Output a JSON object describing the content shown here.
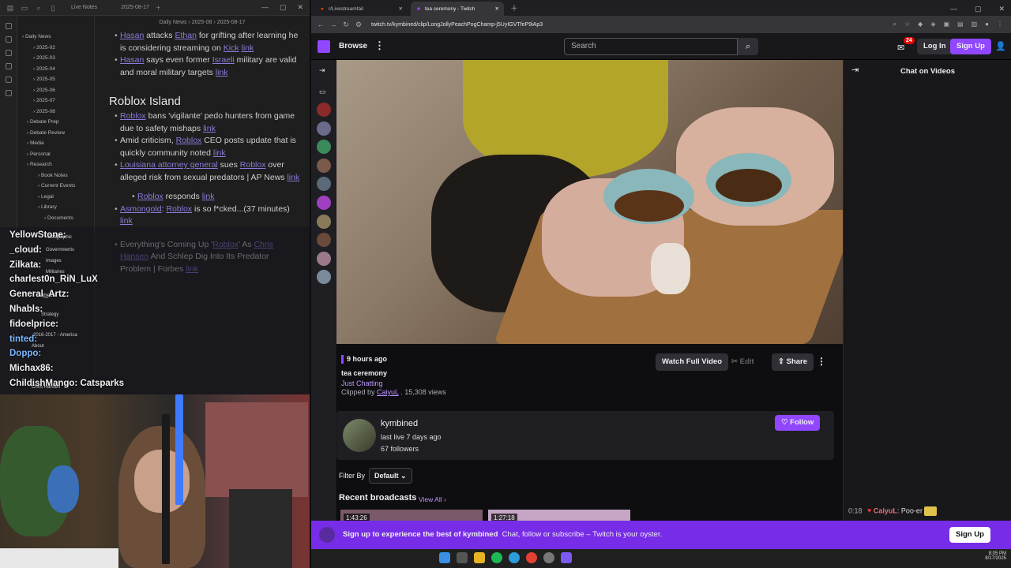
{
  "notes": {
    "window_tab": "Live Notes",
    "tab_date": "2025-08-17",
    "breadcrumb": [
      "Daily News",
      "2025-08",
      "2025-08-17"
    ],
    "tree": [
      "Daily News",
      "2025-02",
      "2025-03",
      "2025-04",
      "2025-05",
      "2025-06",
      "2025-07",
      "2025-08",
      "Debate Prep",
      "Debate Review",
      "Media",
      "Personal",
      "Research",
      "Book Notes",
      "Current Events",
      "Legal",
      "Library",
      "Documents"
    ],
    "items_top": [
      {
        "parts": [
          [
            "Hasan",
            true
          ],
          [
            " attacks ",
            false
          ],
          [
            "Ethan",
            true
          ],
          [
            " for grifting after learning he is considering streaming on ",
            false
          ],
          [
            "Kick",
            true
          ],
          [
            " ",
            false
          ],
          [
            "link",
            true
          ]
        ]
      },
      {
        "parts": [
          [
            "Hasan",
            true
          ],
          [
            " says even former ",
            false
          ],
          [
            "Israeli",
            true
          ],
          [
            " military are valid and moral military targets ",
            false
          ],
          [
            "link",
            true
          ]
        ]
      }
    ],
    "heading": "Roblox Island",
    "items_roblox": [
      {
        "parts": [
          [
            "Roblox",
            true
          ],
          [
            " bans 'vigilante' pedo hunters from game due to safety mishaps ",
            false
          ],
          [
            "link",
            true
          ]
        ]
      },
      {
        "parts": [
          [
            "Amid criticism, ",
            false
          ],
          [
            "Roblox",
            true
          ],
          [
            " CEO posts update that is quickly community noted ",
            false
          ],
          [
            "link",
            true
          ]
        ]
      },
      {
        "parts": [
          [
            "Louisiana attorney general",
            true
          ],
          [
            " sues ",
            false
          ],
          [
            "Roblox",
            true
          ],
          [
            " over alleged risk from sexual predators | AP News ",
            false
          ],
          [
            "link",
            true
          ]
        ]
      },
      {
        "parts": [
          [
            "Roblox",
            true
          ],
          [
            " responds ",
            false
          ],
          [
            "link",
            true
          ]
        ],
        "indent": true
      },
      {
        "parts": [
          [
            "Asmongold",
            true
          ],
          ": ",
          [
            "Roblox",
            true
          ],
          [
            " is so f*cked...(37 minutes) ",
            false
          ],
          [
            "link",
            true
          ]
        ]
      },
      {
        "parts": [
          [
            "Everything's Coming Up '",
            false
          ],
          [
            "Roblox",
            true
          ],
          [
            "' As ",
            false
          ],
          [
            "Chris Hansen",
            true
          ],
          [
            " And Schlep Dig Into Its Predator Problem | Forbes ",
            false
          ],
          [
            "link",
            true
          ]
        ]
      }
    ]
  },
  "overlay_chat": [
    {
      "user": "YellowStone:",
      "msg": ""
    },
    {
      "user": "_cloud:",
      "msg": ""
    },
    {
      "user": "Zilkata:",
      "msg": ""
    },
    {
      "user": "charlest0n_RiN_LuX",
      "msg": ""
    },
    {
      "user": "General_Artz:",
      "msg": ""
    },
    {
      "user": "Nhabls:",
      "msg": ""
    },
    {
      "user": "fidoelprice:",
      "msg": ""
    },
    {
      "user": "tinted:",
      "msg": ""
    },
    {
      "user": "Doppo:",
      "msg": ""
    },
    {
      "user": "Michax86:",
      "msg": ""
    },
    {
      "user": "ChildishMango:",
      "msg": "Catsparks"
    }
  ],
  "overlay_tiny": [
    "Geographic",
    "Governments",
    "Images",
    "Militaries",
    "Subjects",
    "Strategy",
    "2016-2017 - America",
    "About",
    "Chris Hansen"
  ],
  "browser": {
    "tabs": [
      {
        "title": "r/Livestreamfail"
      },
      {
        "title": "tea ceremony - Twitch"
      }
    ],
    "url": "twitch.tv/kymbined/clip/LongJollyPeachPogChamp-j5UyIGVTfeP9iAp3"
  },
  "twitch": {
    "browse": "Browse",
    "search_placeholder": "Search",
    "inbox_badge": "24",
    "login": "Log In",
    "signup": "Sign Up",
    "chat_title": "Chat on Videos",
    "clip": {
      "age": "9 hours ago",
      "title": "tea ceremony",
      "category": "Just Chatting",
      "clipped_by_prefix": "Clipped by ",
      "clipper": "CaiyuL",
      "views": " . 15,308 views",
      "watch_full": "Watch Full Video",
      "edit": "Edit",
      "share": "Share"
    },
    "channel": {
      "name": "kymbined",
      "last_live": "last live 7 days ago",
      "followers": "67 followers",
      "follow": "Follow"
    },
    "filter_label": "Filter By",
    "filter_value": "Default",
    "recent": "Recent broadcasts",
    "view_all": "View All",
    "thumb1_duration": "1:43:26",
    "thumb2_duration": "1:27:18",
    "chat_msg": {
      "time": "0:18",
      "user": "CaiyuL",
      "text": ": Poo-er"
    },
    "banner_bold": "Sign up to experience the best of kymbined",
    "banner_text": "Chat, follow or subscribe – Twitch is your oyster.",
    "banner_signup": "Sign Up"
  },
  "taskbar": {
    "time": "8:05 PM",
    "date": "8/17/2025"
  },
  "colors": {
    "twitch_purple": "#9147ff",
    "banner_purple": "#772ce8",
    "link_purple": "#8a7bd8"
  }
}
